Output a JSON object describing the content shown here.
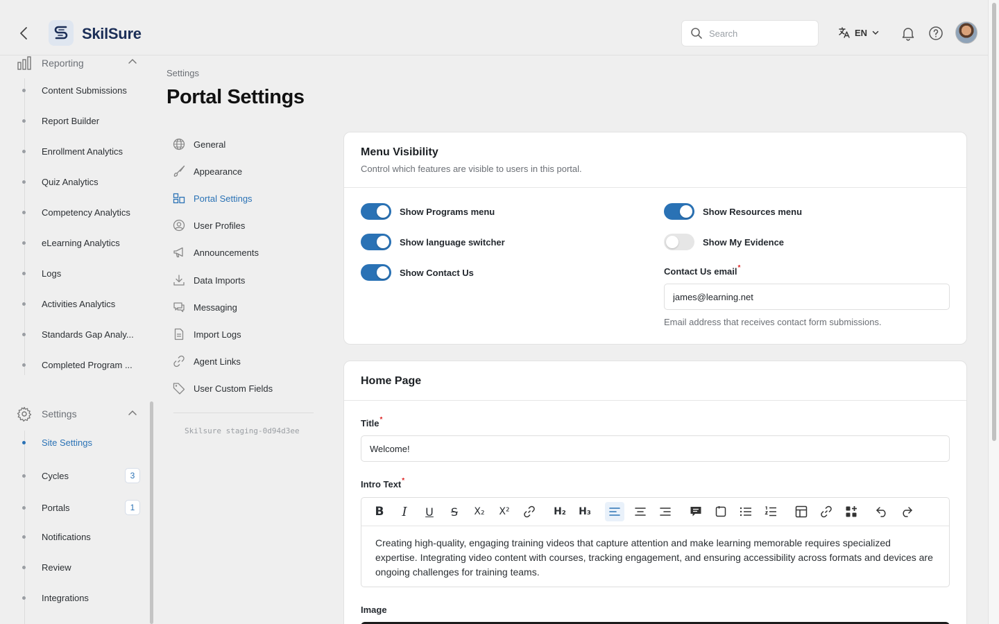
{
  "header": {
    "brand": "SkilSure",
    "search_placeholder": "Search",
    "language": "EN"
  },
  "sidebar": {
    "reporting": {
      "label": "Reporting",
      "items": [
        {
          "label": "Content Submissions"
        },
        {
          "label": "Report Builder"
        },
        {
          "label": "Enrollment Analytics"
        },
        {
          "label": "Quiz Analytics"
        },
        {
          "label": "Competency Analytics"
        },
        {
          "label": "eLearning Analytics"
        },
        {
          "label": "Logs"
        },
        {
          "label": "Activities Analytics"
        },
        {
          "label": "Standards Gap Analy..."
        },
        {
          "label": "Completed Program ..."
        }
      ]
    },
    "settings": {
      "label": "Settings",
      "items": [
        {
          "label": "Site Settings",
          "active": true
        },
        {
          "label": "Cycles",
          "badge": "3"
        },
        {
          "label": "Portals",
          "badge": "1"
        },
        {
          "label": "Notifications"
        },
        {
          "label": "Review"
        },
        {
          "label": "Integrations"
        }
      ]
    }
  },
  "breadcrumb": "Settings",
  "page_title": "Portal Settings",
  "settings_nav": {
    "items": [
      {
        "label": "General",
        "icon": "globe-icon"
      },
      {
        "label": "Appearance",
        "icon": "brush-icon"
      },
      {
        "label": "Portal Settings",
        "icon": "layout-icon",
        "active": true
      },
      {
        "label": "User Profiles",
        "icon": "user-circle-icon"
      },
      {
        "label": "Announcements",
        "icon": "megaphone-icon"
      },
      {
        "label": "Data Imports",
        "icon": "download-icon"
      },
      {
        "label": "Messaging",
        "icon": "chat-icon"
      },
      {
        "label": "Import Logs",
        "icon": "file-icon"
      },
      {
        "label": "Agent Links",
        "icon": "link-icon"
      },
      {
        "label": "User Custom Fields",
        "icon": "tag-icon"
      }
    ],
    "version": "Skilsure staging-0d94d3ee"
  },
  "menu_visibility": {
    "title": "Menu Visibility",
    "subtitle": "Control which features are visible to users in this portal.",
    "toggles": {
      "programs": {
        "label": "Show Programs menu",
        "on": true
      },
      "resources": {
        "label": "Show Resources menu",
        "on": true
      },
      "language": {
        "label": "Show language switcher",
        "on": true
      },
      "evidence": {
        "label": "Show My Evidence",
        "on": false
      },
      "contact": {
        "label": "Show Contact Us",
        "on": true
      }
    },
    "contact_email": {
      "label": "Contact Us email",
      "value": "james@learning.net",
      "hint": "Email address that receives contact form submissions."
    }
  },
  "home_page": {
    "title": "Home Page",
    "title_field": {
      "label": "Title",
      "value": "Welcome!"
    },
    "intro_text": {
      "label": "Intro Text",
      "body": "Creating high-quality, engaging training videos that capture attention and make learning memorable requires specialized expertise. Integrating video content with courses, tracking engagement, and ensuring accessibility across formats and devices are ongoing challenges for training teams."
    },
    "toolbar": {
      "bold": "B",
      "italic": "I",
      "underline": "U",
      "strike": "S",
      "subscript": "X₂",
      "superscript": "X²",
      "h2": "H₂",
      "h3": "H₃"
    },
    "image_label": "Image"
  },
  "colors": {
    "accent": "#2a72b5",
    "background": "#efefef",
    "brand": "#1b2e57"
  }
}
